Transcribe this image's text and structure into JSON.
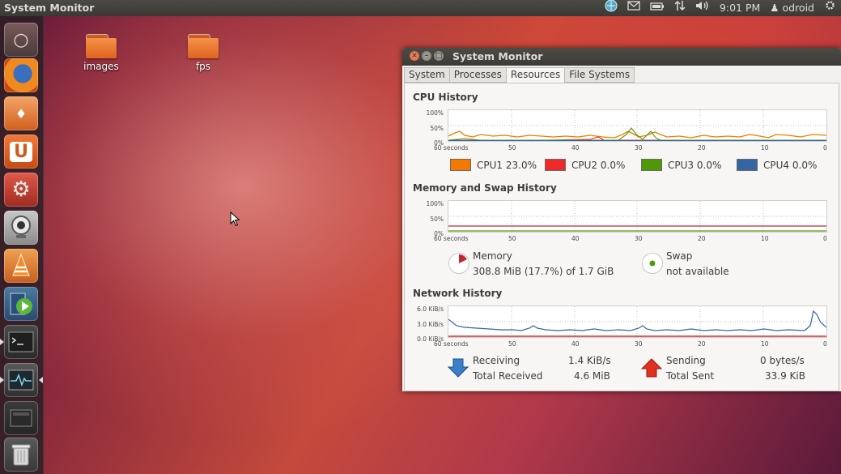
{
  "top_panel": {
    "app_title": "System Monitor",
    "clock": "9:01 PM",
    "user": "odroid",
    "icons": [
      "network-icon",
      "mail-icon",
      "battery-icon",
      "transfer-arrows-icon",
      "volume-icon",
      "user-icon",
      "gear-icon"
    ]
  },
  "launcher": {
    "items": [
      "dash-home-icon",
      "firefox-icon",
      "software-center-icon",
      "ubuntu-one-icon",
      "system-settings-icon",
      "webcam-icon",
      "vlc-icon",
      "media-player-icon",
      "terminal-icon",
      "system-monitor-icon",
      "workspace-switcher-icon",
      "trash-icon"
    ]
  },
  "desktop": {
    "icons": [
      {
        "label": "images"
      },
      {
        "label": "fps"
      }
    ]
  },
  "window": {
    "title": "System Monitor",
    "tabs": [
      "System",
      "Processes",
      "Resources",
      "File Systems"
    ],
    "active_tab": "Resources",
    "cpu": {
      "heading": "CPU History",
      "y_ticks": [
        "100%",
        "50%",
        "0%"
      ],
      "x_ticks": [
        "60 seconds",
        "50",
        "40",
        "30",
        "20",
        "10",
        "0"
      ],
      "legend": [
        {
          "label": "CPU1",
          "value": "23.0%",
          "color": "#f57900"
        },
        {
          "label": "CPU2",
          "value": "0.0%",
          "color": "#ef2929"
        },
        {
          "label": "CPU3",
          "value": "0.0%",
          "color": "#4e9a06"
        },
        {
          "label": "CPU4",
          "value": "0.0%",
          "color": "#3465a4"
        }
      ]
    },
    "memory": {
      "heading": "Memory and Swap History",
      "y_ticks": [
        "100%",
        "50%",
        "0%"
      ],
      "x_ticks": [
        "60 seconds",
        "50",
        "40",
        "30",
        "20",
        "10",
        "0"
      ],
      "memory_label": "Memory",
      "memory_value": "308.8 MiB (17.7%) of 1.7 GiB",
      "memory_color": "#c4262e",
      "memory_fraction": 0.177,
      "swap_label": "Swap",
      "swap_value": "not available",
      "swap_color": "#4e9a06"
    },
    "network": {
      "heading": "Network History",
      "y_ticks": [
        "6.0 KiB/s",
        "3.0 KiB/s",
        "0.0 KiB/s"
      ],
      "x_ticks": [
        "60 seconds",
        "50",
        "40",
        "30",
        "20",
        "10",
        "0"
      ],
      "receiving_label": "Receiving",
      "receiving_value": "1.4 KiB/s",
      "total_received_label": "Total Received",
      "total_received_value": "4.6 MiB",
      "sending_label": "Sending",
      "sending_value": "0 bytes/s",
      "total_sent_label": "Total Sent",
      "total_sent_value": "33.9 KiB",
      "receive_color": "#3465a4",
      "send_color": "#cc0000"
    }
  }
}
